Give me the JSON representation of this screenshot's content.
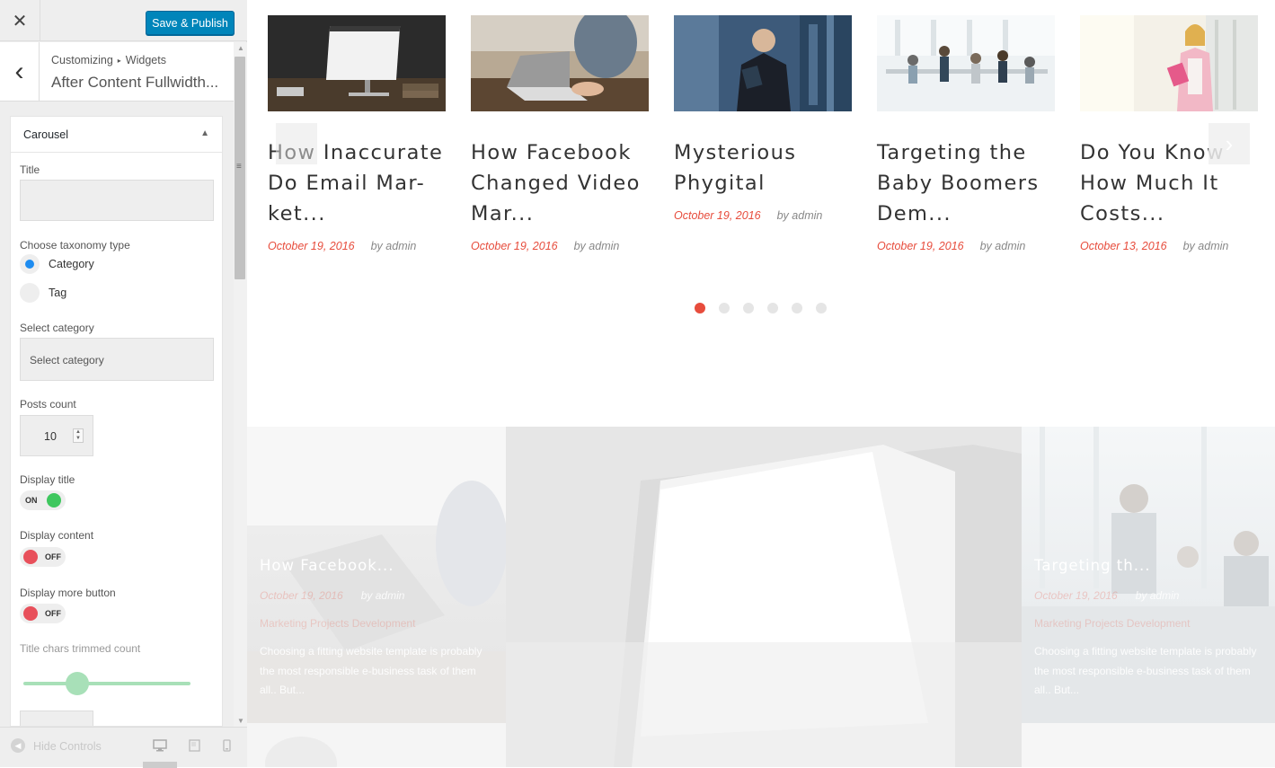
{
  "topbar": {
    "close_symbol": "✕",
    "save_label": "Save & Publish"
  },
  "section": {
    "back_symbol": "‹",
    "breadcrumb": [
      "Customizing",
      "Widgets"
    ],
    "breadcrumb_sep": "▸",
    "title": "After Content Fullwidth..."
  },
  "widget": {
    "title": "Carousel",
    "toggle_symbol": "▲",
    "title_label": "Title",
    "title_value": "",
    "taxonomy_label": "Choose taxonomy type",
    "taxonomy_options": [
      "Category",
      "Tag"
    ],
    "taxonomy_selected": "Category",
    "category_label": "Select category",
    "category_placeholder": "Select category",
    "posts_count_label": "Posts count",
    "posts_count": "10",
    "display_title_label": "Display title",
    "display_title_state": "ON",
    "display_content_label": "Display content",
    "display_content_state": "OFF",
    "display_more_label": "Display more button",
    "display_more_state": "OFF",
    "chars_label": "Title chars trimmed count"
  },
  "footer": {
    "hide_label": "Hide Controls",
    "hide_symbol": "◀"
  },
  "carousel": {
    "next_symbol": "›",
    "posts": [
      {
        "title_lines": [
          "How Inaccurate",
          "Do Email Mar-",
          "ket..."
        ],
        "date": "October 19, 2016",
        "author": "by admin"
      },
      {
        "title_lines": [
          "How Facebook",
          "Changed Video",
          "Mar..."
        ],
        "date": "October 19, 2016",
        "author": "by admin"
      },
      {
        "title_lines": [
          "Mysterious",
          "Phygital"
        ],
        "date": "October 19, 2016",
        "author": "by admin"
      },
      {
        "title_lines": [
          "Targeting the",
          "Baby Boomers",
          "Dem..."
        ],
        "date": "October 19, 2016",
        "author": "by admin"
      },
      {
        "title_lines": [
          "Do You Know",
          "How Much It",
          "Costs..."
        ],
        "date": "October 13, 2016",
        "author": "by admin"
      }
    ],
    "dots": 6,
    "active_dot": 0
  },
  "grid": {
    "left": {
      "title": "How Facebook...",
      "date": "October 19, 2016",
      "author": "by admin",
      "categories": "Marketing   Projects   Development",
      "excerpt": "Choosing a fitting website template is probably the most responsible e-business task of them all.. But..."
    },
    "right": {
      "title": "Targeting th...",
      "date": "October 19, 2016",
      "author": "by admin",
      "categories": "Marketing   Projects   Development",
      "excerpt": "Choosing a fitting website template is probably the most responsible e-business task of them all.. But..."
    }
  },
  "colors": {
    "accent": "#0085ba",
    "date_red": "#e74c3c",
    "toggle_on": "#3ec75e",
    "toggle_off": "#e8505b",
    "radio_blue": "#1e8cf0"
  }
}
